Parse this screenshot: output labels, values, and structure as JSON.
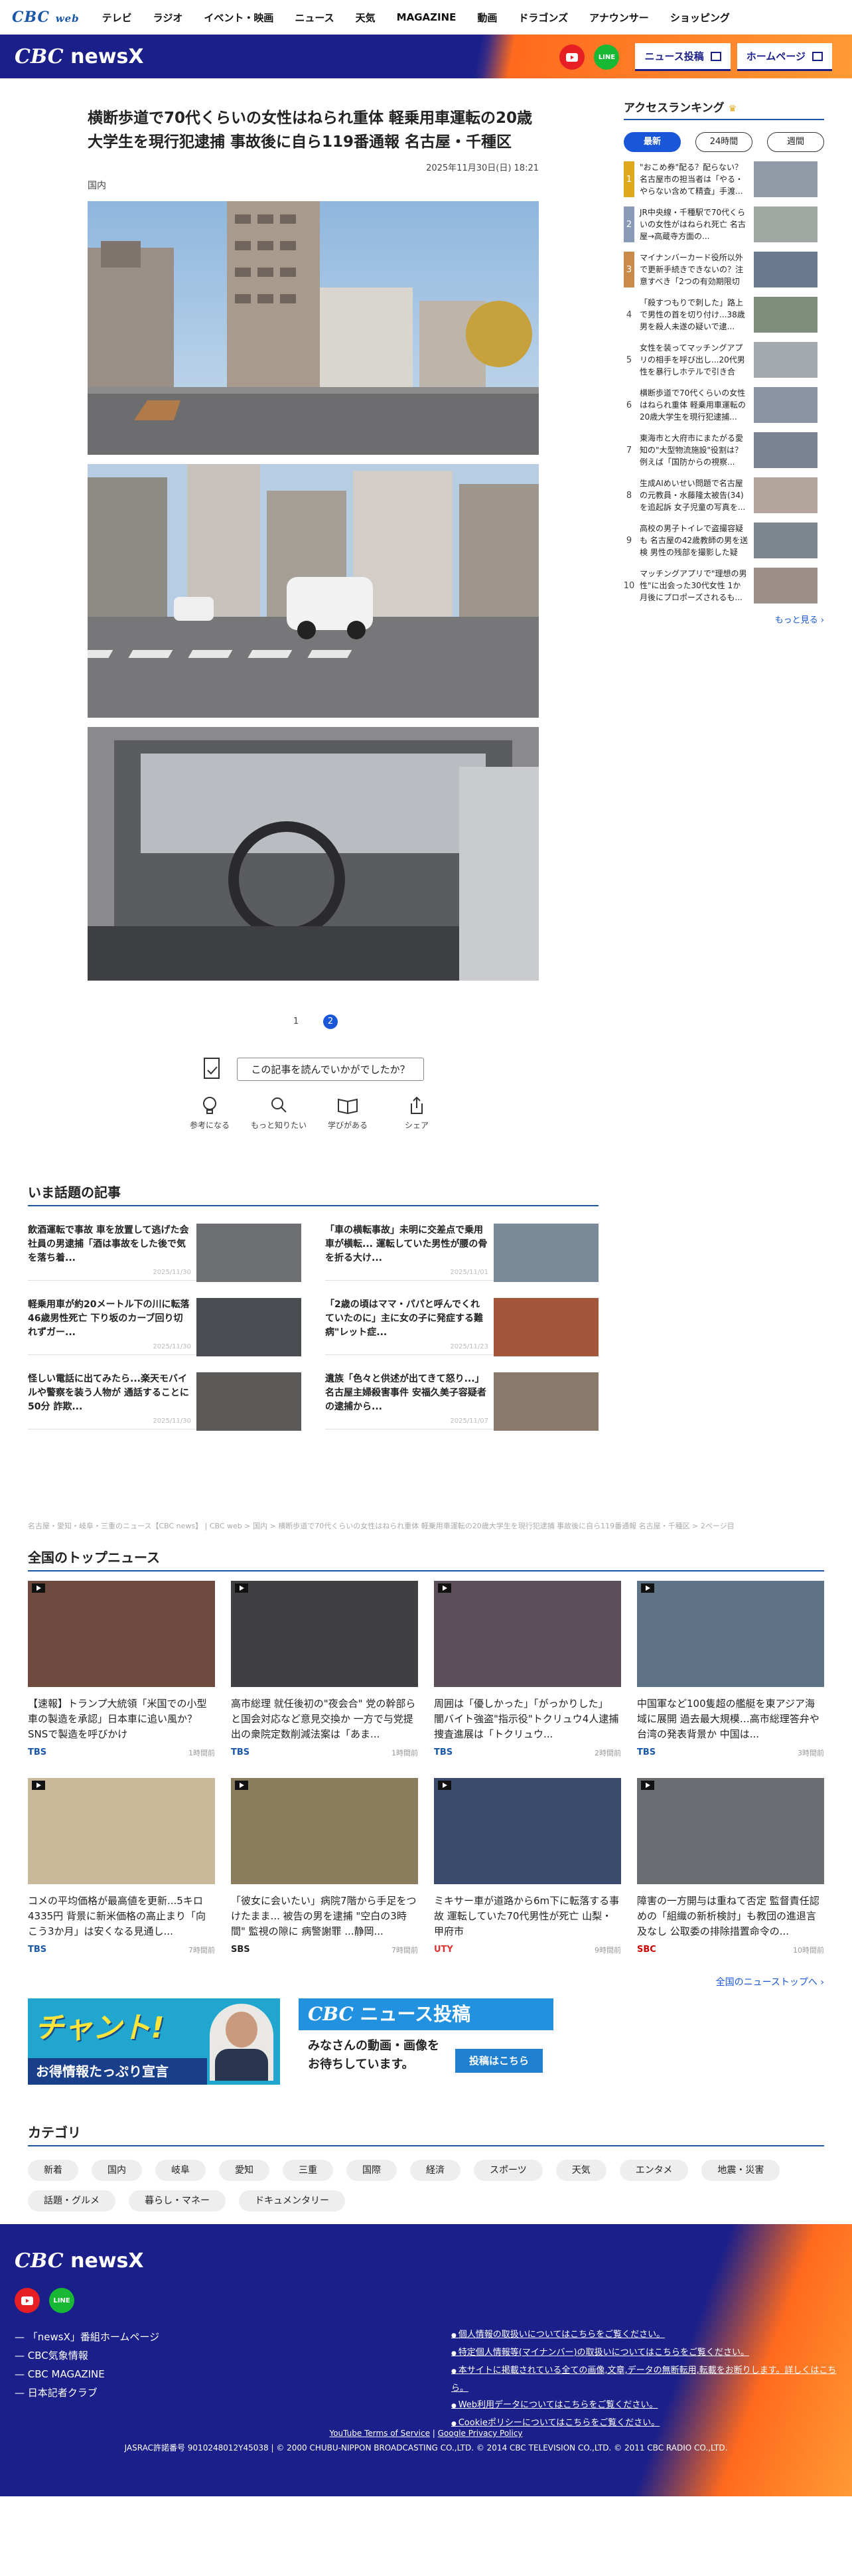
{
  "topnav": {
    "logo": "CBC",
    "logo_suffix": "web",
    "items": [
      "テレビ",
      "ラジオ",
      "イベント・映画",
      "ニュース",
      "天気",
      "MAGAZINE",
      "動画",
      "ドラゴンズ",
      "アナウンサー",
      "ショッピング"
    ]
  },
  "brandbar": {
    "logo": "CBC",
    "logo_suffix": "newsX",
    "news_post": "ニュース投稿",
    "homepage": "ホームページ",
    "line_label": "LINE"
  },
  "article": {
    "title": "横断歩道で70代くらいの女性はねられ重体 軽乗用車運転の20歳大学生を現行犯逮捕 事故後に自ら119番通報 名古屋・千種区",
    "date": "2025年11月30日(日) 18:21",
    "category": "国内",
    "pages": [
      "1",
      "2"
    ],
    "current_page": "2",
    "feedback_question": "この記事を読んでいかがでしたか？",
    "reactions": [
      "参考になる",
      "もっと知りたい",
      "学びがある",
      "シェア"
    ]
  },
  "ranking": {
    "title": "アクセスランキング",
    "tabs": [
      "最新",
      "24時間",
      "週間"
    ],
    "items": [
      {
        "num": "1",
        "text": "\"おこめ券\"配る？配らない？名古屋市の担当者は「やる・やらない含めて精査」手渡..."
      },
      {
        "num": "2",
        "text": "JR中央線・千種駅で70代くらいの女性がはねられ死亡 名古屋→高蔵寺方面の..."
      },
      {
        "num": "3",
        "text": "マイナンバーカード役所以外で更新手続きできないの？注意すべき「2つの有効期限切れ」..."
      },
      {
        "num": "4",
        "text": "「殺すつもりで刺した」路上で男性の首を切り付け...38歳男を殺人未遂の疑いで逮..."
      },
      {
        "num": "5",
        "text": "女性を装ってマッチングアプリの相手を呼び出し...20代男性を暴行しホテルで引き合わ..."
      },
      {
        "num": "6",
        "text": "横断歩道で70代くらいの女性はねられ重体 軽乗用車運転の20歳大学生を現行犯逮捕..."
      },
      {
        "num": "7",
        "text": "東海市と大府市にまたがる愛知の\"大型物流施設\"役割は？例えば「国防からの視察..."
      },
      {
        "num": "8",
        "text": "生成AIめいせい問題で名古屋の元教員・水藤隆太被告(34)を追起訴 女子児童の写真を..."
      },
      {
        "num": "9",
        "text": "高校の男子トイレで盗撮容疑も 名古屋の42歳教師の男を送検 男性の残部を撮影した疑い..."
      },
      {
        "num": "10",
        "text": "マッチングアプリで\"理想の男性\"に出会った30代女性 1か月後にプロポーズされるも..."
      }
    ],
    "more": "もっと見る"
  },
  "trending": {
    "title": "いま話題の記事",
    "items": [
      {
        "text": "飲酒運転で事故 車を放置して逃げた会社員の男逮捕「酒は事故をした後で気を落ち着...",
        "date": "2025/11/30"
      },
      {
        "text": "「車の横転事故」未明に交差点で乗用車が横転... 運転していた男性が腰の骨を折る大け...",
        "date": "2025/11/01"
      },
      {
        "text": "軽乗用車が約20メートル下の川に転落 46歳男性死亡 下り坂のカーブ回り切れずガー...",
        "date": "2025/11/30"
      },
      {
        "text": "「2歳の頃はママ・パパと呼んでくれていたのに」主に女の子に発症する難病\"レット症...",
        "date": "2025/11/23"
      },
      {
        "text": "怪しい電話に出てみたら...楽天モバイルや警察を装う人物が 通話することに50分 詐欺...",
        "date": "2025/11/30"
      },
      {
        "text": "遺族「色々と供述が出てきて怒り...」名古屋主婦殺害事件 安福久美子容疑者の逮捕から...",
        "date": "2025/11/07"
      }
    ]
  },
  "breadcrumb": "名古屋・愛知・岐阜・三重のニュース【CBC news】 | CBC web > 国内 > 横断歩道で70代くらいの女性はねられ重体 軽乗用車運転の20歳大学生を現行犯逮捕 事故後に自ら119番通報 名古屋・千種区 > 2ページ目",
  "national": {
    "title": "全国のトップニュース",
    "items": [
      {
        "title": "【速報】トランプ大統領「米国での小型車の製造を承認」日本車に追い風か？ SNSで製造を呼びかけ",
        "source": "TBS",
        "time": "1時間前",
        "src_color": "#1a57a8"
      },
      {
        "title": "高市総理 就任後初の\"夜会合\" 党の幹部らと国会対応など意見交換か 一方で与党提出の衆院定数削減法案は「あま...",
        "source": "TBS",
        "time": "1時間前",
        "src_color": "#1a57a8"
      },
      {
        "title": "周囲は「優しかった」「がっかりした」 闇バイト強盗\"指示役\"トクリュウ4人逮捕 捜査進展は「トクリュウ...",
        "source": "TBS",
        "time": "2時間前",
        "src_color": "#1a57a8"
      },
      {
        "title": "中国軍など100隻超の艦艇を東アジア海域に展開 過去最大規模…高市総理答弁や台湾の発表背景か 中国は...",
        "source": "TBS",
        "time": "3時間前",
        "src_color": "#1a57a8"
      },
      {
        "title": "コメの平均価格が最高値を更新...5キロ4335円 背景に新米価格の高止まり「向こう3か月」は安くなる見通し...",
        "source": "TBS",
        "time": "7時間前",
        "src_color": "#1a57a8"
      },
      {
        "title": "「彼女に会いたい」病院7階から手足をつけたまま... 被告の男を逮捕 \"空白の3時間\" 監視の隙に 病警謝罪 ...静岡...",
        "source": "SBS",
        "time": "7時間前",
        "src_color": "#222"
      },
      {
        "title": "ミキサー車が道路から6m下に転落する事故 運転していた70代男性が死亡 山梨・甲府市",
        "source": "UTY",
        "time": "9時間前",
        "src_color": "#d33"
      },
      {
        "title": "障害の一方開与は重ねて否定 監督責任認めの「組織の新析検討」も教団の進退言及なし 公取委の排除措置命令の...",
        "source": "SBC",
        "time": "10時間前",
        "src_color": "#c00"
      }
    ],
    "more": "全国のニューストップへ"
  },
  "banners": {
    "left_title": "チャント!",
    "left_sub": "お得情報たっぷり宣言",
    "right_title_a": "CBC",
    "right_title_b": "ニュース投稿",
    "right_line1": "みなさんの動画・画像を",
    "right_line2": "お待ちしています。",
    "right_button": "投稿はこちら"
  },
  "category": {
    "title": "カテゴリ",
    "chips": [
      "新着",
      "国内",
      "岐阜",
      "愛知",
      "三重",
      "国際",
      "経済",
      "スポーツ",
      "天気",
      "エンタメ",
      "地震・災害",
      "話題・グルメ",
      "暮らし・マネー",
      "ドキュメンタリー"
    ]
  },
  "footer": {
    "logo": "CBC",
    "logo_suffix": "newsX",
    "line_label": "LINE",
    "links": [
      "「newsX」番組ホームページ",
      "CBC気象情報",
      "CBC MAGAZINE",
      "日本記者クラブ"
    ],
    "policies": [
      "個人情報の取扱いについてはこちらをご覧ください。",
      "特定個人情報等(マイナンバー)の取扱いについてはこちらをご覧ください。",
      "本サイトに掲載されている全ての画像,文章,データの無断転用,転載をお断りします。詳しくはこちら。",
      "Web利用データについてはこちらをご覧ください。",
      "Cookieポリシーについてはこちらをご覧ください。"
    ],
    "youtube_terms": "YouTube Terms of Service",
    "google_privacy": "Google Privacy Policy",
    "copyright": "JASRAC許諾番号 9010248012Y45038 | © 2000 CHUBU-NIPPON BROADCASTING CO.,LTD. © 2014 CBC TELEVISION CO.,LTD. © 2011 CBC RADIO CO.,LTD."
  },
  "colors": {
    "brand_navy": "#1a1f8a",
    "brand_orange": "#ff8a2a",
    "accent_blue": "#1a57d8"
  }
}
